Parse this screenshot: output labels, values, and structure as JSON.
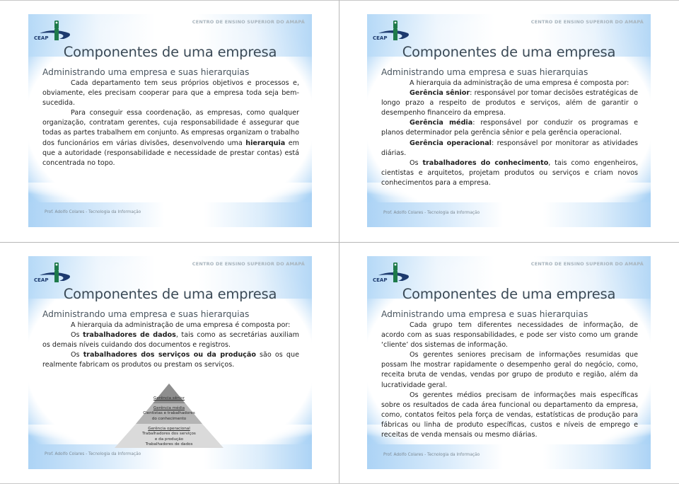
{
  "common": {
    "org_name": "CENTRO DE ENSINO SUPERIOR DO AMAPÁ",
    "logo_text": "CEAP",
    "title": "Componentes de uma empresa",
    "subtitle": "Administrando uma empresa e suas hierarquias",
    "footer": "Prof. Adolfo Colares - Tecnologia da Informação",
    "colors": {
      "title": "#3b4a56",
      "accent_blue": "#a9d2f5",
      "logo_navy": "#1d3a6e",
      "logo_green": "#1e7a4a"
    }
  },
  "slides": [
    {
      "paragraphs": [
        {
          "text": "Cada departamento tem seus próprios objetivos e processos e, obviamente, eles precisam cooperar para que a empresa toda seja bem-sucedida."
        },
        {
          "text": "Para conseguir essa coordenação, as empresas, como qualquer organização, contratam gerentes, cuja responsabilidade é assegurar que todas as partes trabalhem em conjunto. As empresas organizam o trabalho dos funcionários em várias divisões, desenvolvendo uma ",
          "bold": "hierarquia",
          "after": " em que a autoridade (responsabilidade e necessidade de prestar contas) está concentrada no topo."
        }
      ]
    },
    {
      "paragraphs": [
        {
          "text": "A hierarquia da administração de uma empresa é composta por:"
        },
        {
          "bold": "Gerência sênior",
          "after": ": responsável por tomar decisões estratégicas de longo prazo a respeito de produtos e serviços, além de garantir o desempenho financeiro da empresa."
        },
        {
          "bold": "Gerência média",
          "after": ": responsável por conduzir os programas e planos determinador pela gerência sênior e pela gerência operacional."
        },
        {
          "bold": "Gerência operacional",
          "after": ": responsável por monitorar as atividades diárias."
        },
        {
          "text": "Os ",
          "bold": "trabalhadores do conhecimento",
          "after": ", tais como engenheiros, cientistas e arquitetos, projetam produtos ou serviços e criam novos conhecimentos para a empresa."
        }
      ]
    },
    {
      "paragraphs": [
        {
          "text": "A hierarquia da administração de uma empresa é composta por:"
        },
        {
          "text": "Os ",
          "bold": "trabalhadores de dados",
          "after": ", tais como as secretárias auxiliam os demais níveis cuidando dos documentos e registros."
        },
        {
          "text": "Os ",
          "bold": "trabalhadores dos serviços ou da produção",
          "after": " são os que realmente fabricam os produtos ou prestam os serviços."
        }
      ],
      "pyramid": {
        "levels": [
          {
            "heading": "Gerência sênior",
            "lines": []
          },
          {
            "heading": "Gerência média",
            "lines": [
              "Cientistas e trabalhadores",
              "do conhecimento"
            ]
          },
          {
            "heading": "Gerência operacional",
            "lines": [
              "Trabalhadores dos serviços",
              "e da produção",
              "Trabalhadores de dados"
            ]
          }
        ],
        "colors": [
          "#8e8e8e",
          "#b4b4b4",
          "#dadada"
        ]
      }
    },
    {
      "paragraphs": [
        {
          "text": "Cada grupo tem diferentes necessidades de informação, de acordo com as suas responsabilidades, e pode ser visto como um grande ‘cliente’ dos sistemas de informação."
        },
        {
          "text": "Os gerentes seniores precisam de informações resumidas que possam lhe mostrar rapidamente o desempenho geral do negócio, como, receita bruta de vendas, vendas por grupo de produto e região, além da lucratividade geral."
        },
        {
          "text": "Os gerentes médios precisam de informações mais específicas sobre os resultados de cada área funcional ou departamento da empresa, como, contatos feitos pela força de vendas, estatísticas de produção para fábricas ou linha de produto específicas, custos e níveis de emprego e receitas de venda mensais ou mesmo diárias."
        }
      ]
    }
  ]
}
